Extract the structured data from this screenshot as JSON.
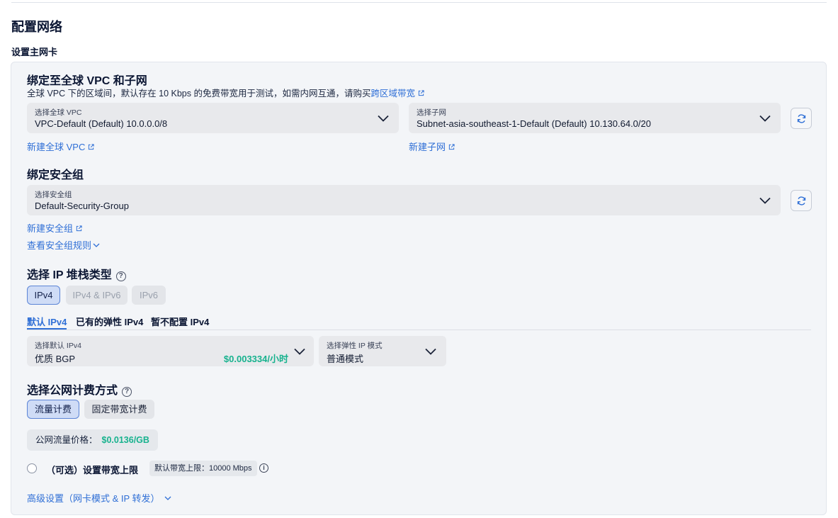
{
  "page_title": "配置网络",
  "section_title": "设置主网卡",
  "vpc": {
    "title": "绑定至全球 VPC 和子网",
    "desc_prefix": "全球 VPC 下的区域间，默认存在 10 Kbps 的免费带宽用于测试，如需内网互通，请购买",
    "desc_link": "跨区域带宽",
    "vpc_select_label": "选择全球 VPC",
    "vpc_select_value": "VPC-Default (Default) 10.0.0.0/8",
    "subnet_select_label": "选择子网",
    "subnet_select_value": "Subnet-asia-southeast-1-Default (Default) 10.130.64.0/20",
    "new_vpc_link": "新建全球 VPC",
    "new_subnet_link": "新建子网"
  },
  "security_group": {
    "title": "绑定安全组",
    "select_label": "选择安全组",
    "select_value": "Default-Security-Group",
    "new_link": "新建安全组",
    "view_rules_link": "查看安全组规则"
  },
  "ip_stack": {
    "title": "选择 IP 堆栈类型",
    "options": [
      "IPv4",
      "IPv4 & IPv6",
      "IPv6"
    ],
    "tabs": [
      "默认 IPv4",
      "已有的弹性 IPv4",
      "暂不配置 IPv4"
    ],
    "ipv4_select_label": "选择默认 IPv4",
    "ipv4_select_value": "优质 BGP",
    "ipv4_price": "$0.003334/小时",
    "eip_mode_label": "选择弹性 IP 模式",
    "eip_mode_value": "普通模式"
  },
  "billing": {
    "title": "选择公网计费方式",
    "options": [
      "流量计费",
      "固定带宽计费"
    ],
    "price_label": "公网流量价格：",
    "price_value": "$0.0136/GB",
    "bandwidth_label": "（可选）设置带宽上限",
    "bandwidth_tag": "默认带宽上限：10000 Mbps"
  },
  "advanced_link": "高级设置（网卡模式 & IP 转发）",
  "colors": {
    "accent": "#2f6fd6",
    "price": "#17b28e"
  }
}
